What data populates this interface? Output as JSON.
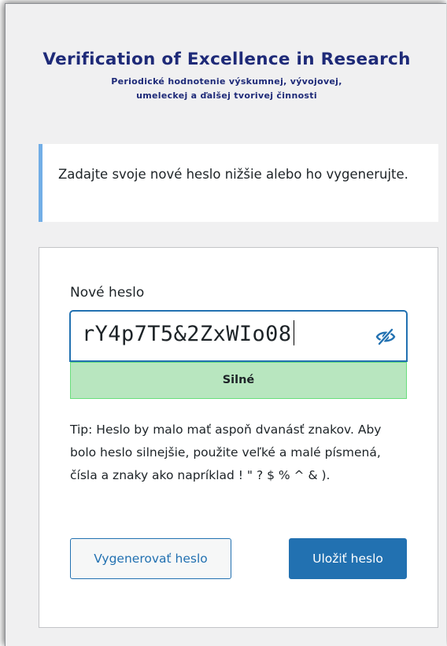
{
  "header": {
    "title": "Verification of Excellence in Research",
    "subtitle_line1": "Periodické hodnotenie výskumnej, vývojovej,",
    "subtitle_line2": "umeleckej a ďalšej tvorivej činnosti"
  },
  "message": {
    "text": "Zadajte svoje nové heslo nižšie alebo ho vygenerujte."
  },
  "form": {
    "password_label": "Nové heslo",
    "password_value": "rY4p7T5&2ZxWIo08",
    "toggle_icon": "eye-slash-icon",
    "strength_label": "Silné",
    "hint": "Tip: Heslo by malo mať aspoň dvanásť znakov. Aby bolo heslo silnejšie, použite veľké a malé písmená, čísla a znaky ako napríklad ! \" ? $ % ^ & ).",
    "generate_label": "Vygenerovať heslo",
    "save_label": "Uložiť heslo"
  },
  "colors": {
    "brand": "#1e2a78",
    "accent": "#2271b1",
    "notice_border": "#72aee6",
    "strength_bg": "#b8e6bf"
  }
}
